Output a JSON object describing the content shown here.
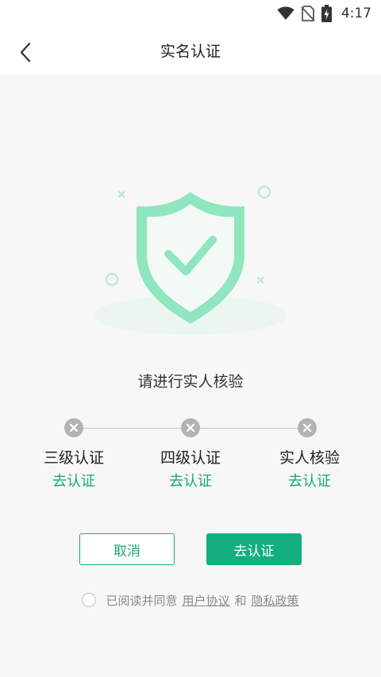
{
  "status_bar": {
    "time": "4:17",
    "icons": [
      "wifi-icon",
      "no-sim-icon",
      "battery-charging-icon"
    ]
  },
  "nav": {
    "title": "实名认证",
    "back_icon": "chevron-left-icon"
  },
  "prompt": "请进行实人核验",
  "steps": [
    {
      "label": "三级认证",
      "action": "去认证",
      "status_icon": "close-circle-icon"
    },
    {
      "label": "四级认证",
      "action": "去认证",
      "status_icon": "close-circle-icon"
    },
    {
      "label": "实人核验",
      "action": "去认证",
      "status_icon": "close-circle-icon"
    }
  ],
  "buttons": {
    "cancel": "取消",
    "verify": "去认证"
  },
  "agreement": {
    "prefix": "已阅读并同意",
    "user_agreement": "用户协议",
    "conjunction": "和",
    "privacy_policy": "隐私政策"
  },
  "colors": {
    "accent": "#14ae7f",
    "link": "#1aa57a",
    "shield": "#8fe6bf",
    "inactive": "#b3b3b3"
  }
}
